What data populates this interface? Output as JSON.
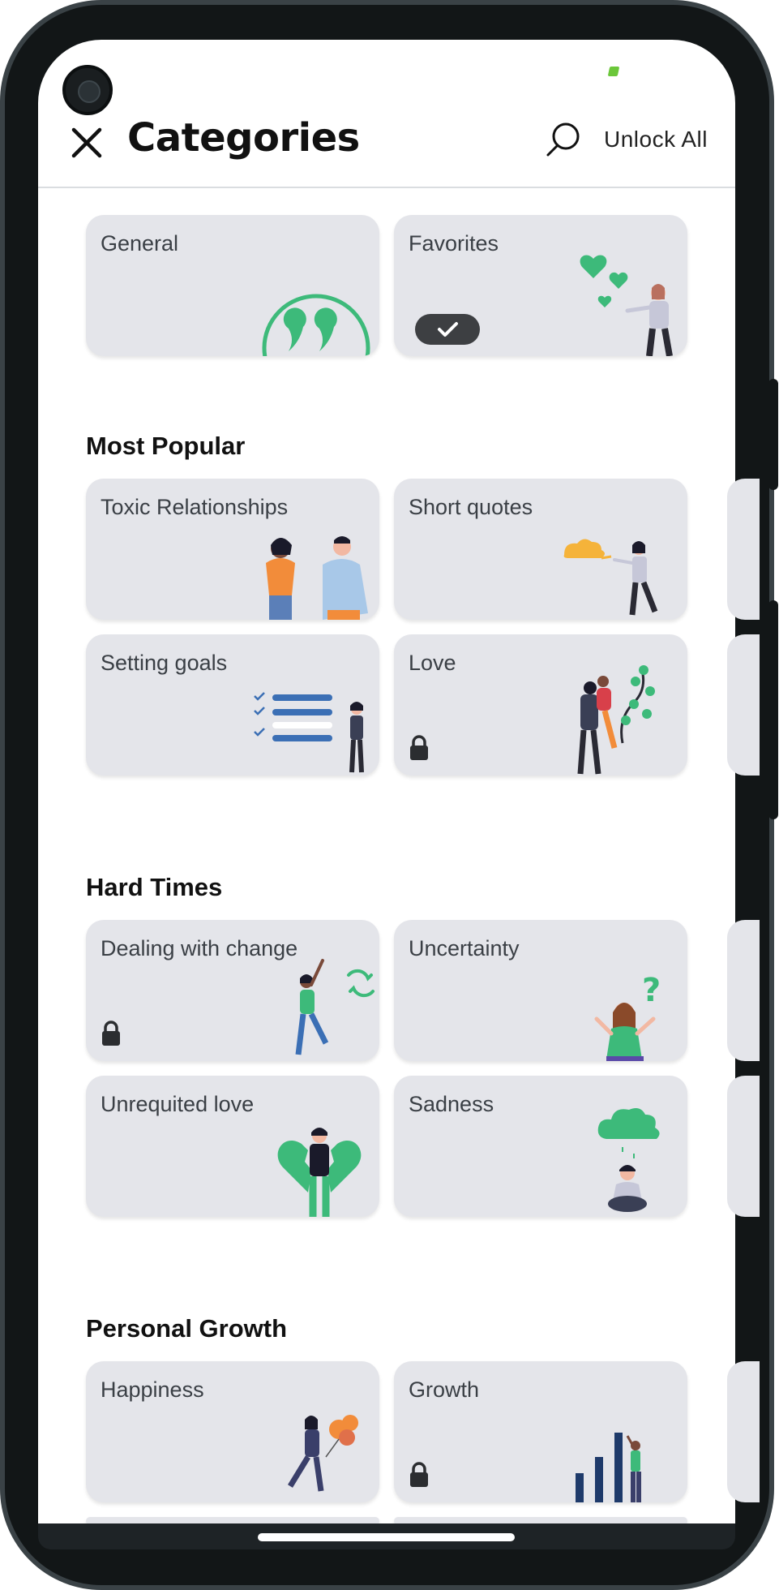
{
  "header": {
    "title": "Categories",
    "unlock_all_label": "Unlock All"
  },
  "top_cards": [
    {
      "label": "General",
      "icon": "quote-icon",
      "locked": false
    },
    {
      "label": "Favorites",
      "icon": "hearts-illustration",
      "selected": true
    }
  ],
  "sections": [
    {
      "title": "Most Popular",
      "cards": [
        {
          "label": "Toxic Relationships",
          "locked": false
        },
        {
          "label": "Short quotes",
          "locked": false
        },
        {
          "label": "Setting goals",
          "locked": false
        },
        {
          "label": "Love",
          "locked": true
        }
      ]
    },
    {
      "title": "Hard Times",
      "cards": [
        {
          "label": "Dealing with change",
          "locked": true
        },
        {
          "label": "Uncertainty",
          "locked": false
        },
        {
          "label": "Unrequited love",
          "locked": false
        },
        {
          "label": "Sadness",
          "locked": false
        }
      ]
    },
    {
      "title": "Personal Growth",
      "cards": [
        {
          "label": "Happiness",
          "locked": false
        },
        {
          "label": "Growth",
          "locked": true
        }
      ]
    }
  ],
  "colors": {
    "accent_green": "#3dba7a",
    "card_bg": "#e4e5ea",
    "frame": "#121617"
  }
}
